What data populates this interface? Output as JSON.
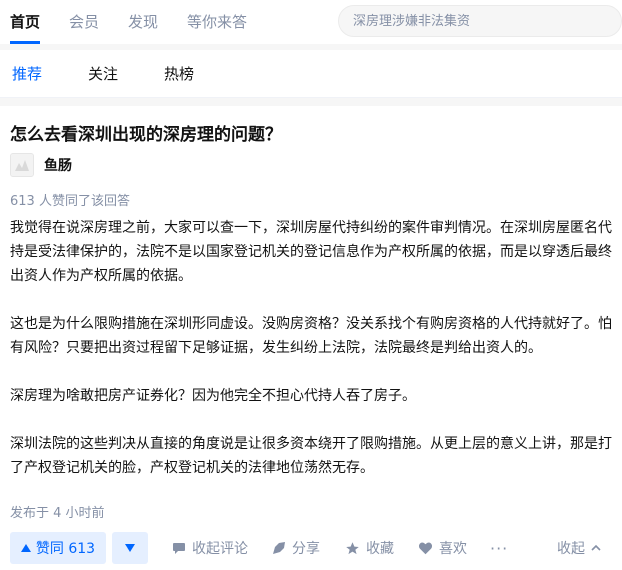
{
  "topnav": {
    "items": [
      {
        "label": "首页"
      },
      {
        "label": "会员"
      },
      {
        "label": "发现"
      },
      {
        "label": "等你来答"
      }
    ],
    "active_index": 0
  },
  "search": {
    "placeholder": "深房理涉嫌非法集资"
  },
  "feed_tabs": {
    "items": [
      {
        "label": "推荐"
      },
      {
        "label": "关注"
      },
      {
        "label": "热榜"
      }
    ],
    "active_index": 0
  },
  "answer": {
    "question_title": "怎么去看深圳出现的深房理的问题？",
    "author_name": "鱼肠",
    "voters_text": "613 人赞同了该回答",
    "paragraphs": [
      "我觉得在说深房理之前，大家可以查一下，深圳房屋代持纠纷的案件审判情况。在深圳房屋匿名代持是受法律保护的，法院不是以国家登记机关的登记信息作为产权所属的依据，而是以穿透后最终出资人作为产权所属的依据。",
      "这也是为什么限购措施在深圳形同虚设。没购房资格？没关系找个有购房资格的人代持就好了。怕有风险？只要把出资过程留下足够证据，发生纠纷上法院，法院最终是判给出资人的。",
      "深房理为啥敢把房产证券化？因为他完全不担心代持人吞了房子。",
      "深圳法院的这些判决从直接的角度说是让很多资本绕开了限购措施。从更上层的意义上讲，那是打了产权登记机关的脸，产权登记机关的法律地位荡然无存。"
    ],
    "published": "发布于 4 小时前"
  },
  "actions": {
    "vote_up_label": "赞同 613",
    "comment_label": "收起评论",
    "share_label": "分享",
    "favorite_label": "收藏",
    "like_label": "喜欢",
    "more_label": "···",
    "collapse_label": "收起"
  },
  "colors": {
    "accent": "#0066ff",
    "muted": "#8590a6",
    "vote_bg": "#e5efff",
    "text": "#121212"
  }
}
